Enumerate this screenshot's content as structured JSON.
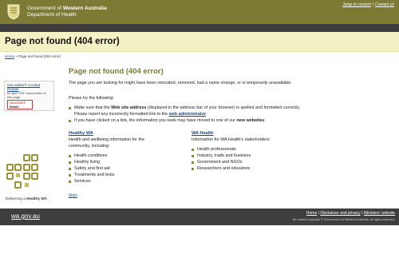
{
  "header": {
    "gov_prefix": "Government of ",
    "gov_state": "Western Australia",
    "department": "Department of Health",
    "jump_link": "Jump to content",
    "separator": "|",
    "contact_link": "Contact us",
    "brand_color": "#7d7a35"
  },
  "title_band": {
    "heading": "Page not found (404 error)"
  },
  "breadcrumb": {
    "home": "Home",
    "separator": " » ",
    "current": "Page not found (404 error)"
  },
  "sidebar": {
    "adobe_title": "Get Adobe® Acrobat Reader",
    "adobe_desc": "to open PDF documents on this page.",
    "badge_get": "Get ADOBE®",
    "badge_name": "Reader",
    "logo_caption_prefix": "Delivering a ",
    "logo_caption_bold": "Healthy WA"
  },
  "main": {
    "title": "Page not found (404 error)",
    "para1": "The page you are looking for might have been relocated, removed, had a name change, or is temporarily unavailable.",
    "para2": "Please try the following:",
    "suggestion1_a": "Make sure that the ",
    "suggestion1_b": "Web site address",
    "suggestion1_c": " (displayed in the address bar of your browser) is spelled and formatted correctly. Please report any incorrectly formatted link to the ",
    "suggestion1_link": "web administrator",
    "suggestion1_end": ".",
    "suggestion2_a": "If you have clicked on a link, the information you seek may have moved to one of our ",
    "suggestion2_b": "new websites",
    "suggestion2_end": ":",
    "healthy_title": "Healthy WA",
    "healthy_desc": "Health and wellbeing information for the community, including:",
    "healthy_items": [
      "Health conditions",
      "Healthy living",
      "Safety and first aid",
      "Treatments and tests",
      "Services"
    ],
    "wahealth_title": "WA Health",
    "wahealth_desc": "Information for WA Health's stakeholders:",
    "wahealth_items": [
      "Health professionals",
      "Industry, trade and business",
      "Government and NGOs",
      "Researchers and educators"
    ],
    "top_link": "(top)"
  },
  "footer": {
    "logo": "wa.gov.au",
    "home": "Home",
    "sep": " | ",
    "disclaimer": "Disclaimer and privacy",
    "ministers": "Ministers' website",
    "copyright": "All content copyright © Government of Western Australia. All rights reserved."
  },
  "icons": {
    "crest": "wa-crest-icon",
    "bullet": "square-bullet-icon",
    "logo": "healthy-wa-logo"
  }
}
